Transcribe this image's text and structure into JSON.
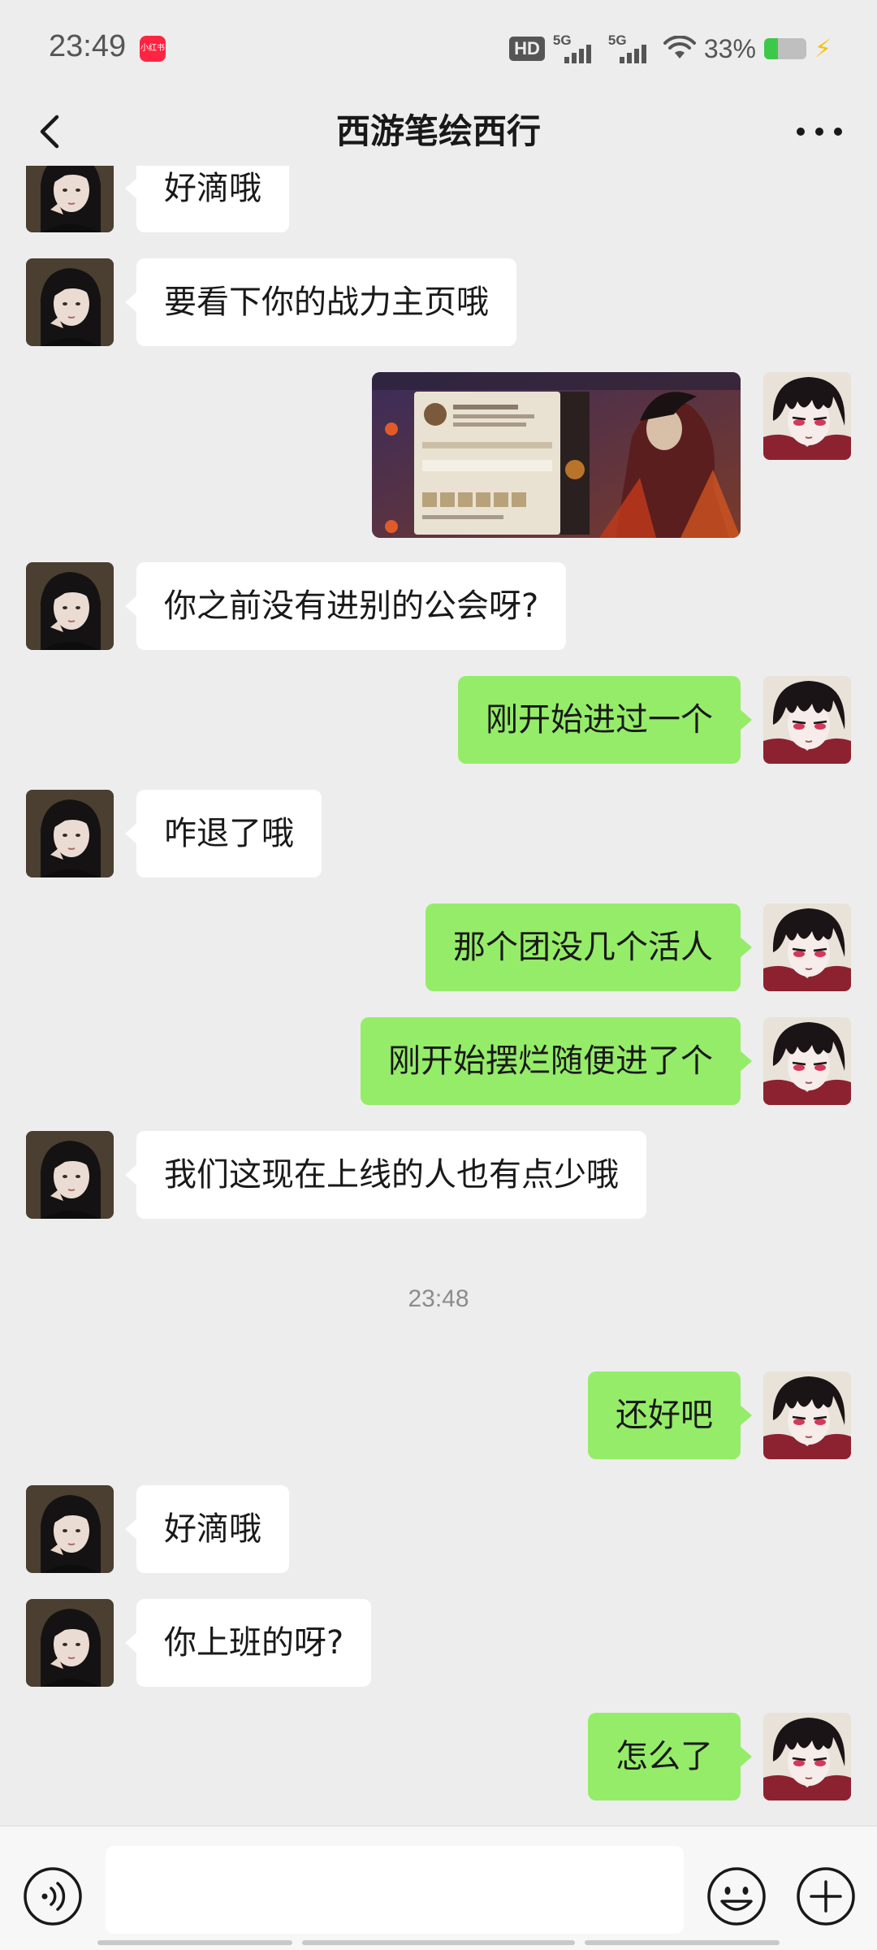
{
  "status_bar": {
    "time": "23:49",
    "app_badge": "小红书",
    "hd": "HD",
    "network1": "5G",
    "network2": "5G",
    "battery_pct": "33%",
    "battery_level": 0.33,
    "icons": [
      "wifi-icon",
      "battery-icon",
      "charging-icon"
    ]
  },
  "nav": {
    "title": "西游笔绘西行",
    "icons": [
      "back-chevron-icon",
      "more-dots-icon"
    ]
  },
  "messages": [
    {
      "side": "left",
      "type": "text",
      "text": "好滴哦"
    },
    {
      "side": "left",
      "type": "text",
      "text": "要看下你的战力主页哦"
    },
    {
      "side": "right",
      "type": "image",
      "text": "",
      "image_label": "game-profile-screenshot"
    },
    {
      "side": "left",
      "type": "text",
      "text": "你之前没有进别的公会呀?"
    },
    {
      "side": "right",
      "type": "text",
      "text": "刚开始进过一个"
    },
    {
      "side": "left",
      "type": "text",
      "text": "咋退了哦"
    },
    {
      "side": "right",
      "type": "text",
      "text": "那个团没几个活人"
    },
    {
      "side": "right",
      "type": "text",
      "text": "刚开始摆烂随便进了个"
    },
    {
      "side": "left",
      "type": "text",
      "text": "我们这现在上线的人也有点少哦"
    },
    {
      "side": "divider",
      "type": "time",
      "text": "23:48"
    },
    {
      "side": "right",
      "type": "text",
      "text": "还好吧"
    },
    {
      "side": "left",
      "type": "text",
      "text": "好滴哦"
    },
    {
      "side": "left",
      "type": "text",
      "text": "你上班的呀?"
    },
    {
      "side": "right",
      "type": "text",
      "text": "怎么了"
    }
  ],
  "input_bar": {
    "placeholder": "",
    "value": "",
    "icons": [
      "voice-icon",
      "emoji-icon",
      "plus-icon"
    ]
  },
  "colors": {
    "background": "#ededed",
    "bubble_self": "#95ec69",
    "bubble_other": "#ffffff",
    "text": "#191919",
    "time": "#8c8c8c"
  }
}
